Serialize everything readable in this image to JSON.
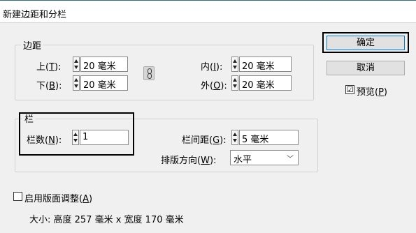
{
  "dialog": {
    "title": "新建边距和分栏"
  },
  "margins": {
    "legend": "边距",
    "top": {
      "label": "上(",
      "key": "T",
      "tail": "):",
      "value": "20 毫米"
    },
    "bottom": {
      "label": "下(",
      "key": "B",
      "tail": "):",
      "value": "20 毫米"
    },
    "inside": {
      "label": "内(",
      "key": "I",
      "tail": "):",
      "value": "20 毫米"
    },
    "outside": {
      "label": "外(",
      "key": "O",
      "tail": "):",
      "value": "20 毫米"
    },
    "link_icon": "chain-link-icon"
  },
  "columns": {
    "legend": "栏",
    "number": {
      "label": "栏数(",
      "key": "N",
      "tail": "):",
      "value": "1"
    },
    "gutter": {
      "label": "栏间距(",
      "key": "G",
      "tail": "):",
      "value": "5 毫米"
    },
    "direction": {
      "label": "排版方向(",
      "key": "W",
      "tail": "):",
      "value": "水平"
    }
  },
  "buttons": {
    "ok": "确定",
    "cancel": "取消"
  },
  "preview": {
    "label": "预览(",
    "key": "P",
    "tail": ")",
    "checked": true,
    "checkmark": "☑"
  },
  "layout_adjust": {
    "label": "启用版面调整(",
    "key": "A",
    "tail": ")",
    "checked": false
  },
  "size_info": "大小: 高度 257 毫米 x 宽度 170 毫米",
  "colors": {
    "accent": "#0078d7",
    "titlebar_border": "#2b6f8f"
  }
}
